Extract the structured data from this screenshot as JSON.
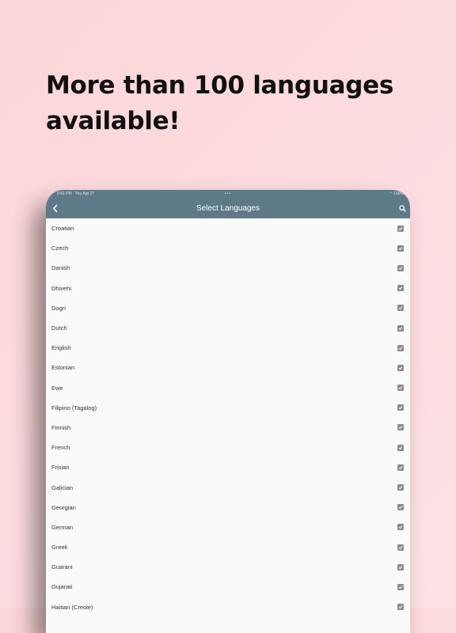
{
  "headline": "More than 100 languages available!",
  "status_bar": {
    "time": "9:41 PM",
    "date": "Thu Apr 27",
    "dots": "•••",
    "battery": "100%"
  },
  "nav": {
    "title": "Select Languages",
    "back_icon": "chevron-left-icon",
    "search_icon": "search-icon"
  },
  "colors": {
    "background": "#fcd8dc",
    "nav_bar": "#5e7a88",
    "checkbox": "#8b8b8b"
  },
  "languages": [
    {
      "label": "Croatian",
      "checked": true
    },
    {
      "label": "Czech",
      "checked": true
    },
    {
      "label": "Danish",
      "checked": true
    },
    {
      "label": "Dhivehi",
      "checked": true
    },
    {
      "label": "Dogri",
      "checked": true
    },
    {
      "label": "Dutch",
      "checked": true
    },
    {
      "label": "English",
      "checked": true
    },
    {
      "label": "Estonian",
      "checked": true
    },
    {
      "label": "Ewe",
      "checked": true
    },
    {
      "label": "Filipino (Tagalog)",
      "checked": true
    },
    {
      "label": "Finnish",
      "checked": true
    },
    {
      "label": "French",
      "checked": true
    },
    {
      "label": "Frisian",
      "checked": true
    },
    {
      "label": "Galician",
      "checked": true
    },
    {
      "label": "Georgian",
      "checked": true
    },
    {
      "label": "German",
      "checked": true
    },
    {
      "label": "Greek",
      "checked": true
    },
    {
      "label": "Guarani",
      "checked": true
    },
    {
      "label": "Gujarati",
      "checked": true
    },
    {
      "label": "Haitian (Creole)",
      "checked": true
    }
  ]
}
